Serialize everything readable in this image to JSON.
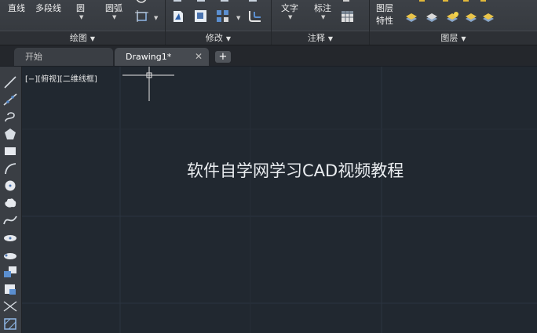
{
  "ribbon": {
    "draw": {
      "title": "绘图",
      "line": "直线",
      "polyline": "多段线",
      "circle": "圆",
      "arc": "圆弧"
    },
    "modify": {
      "title": "修改"
    },
    "annotation": {
      "title": "注释",
      "text": "文字",
      "dimension": "标注"
    },
    "layers": {
      "title": "图层",
      "layer": "图层",
      "properties": "特性"
    }
  },
  "tabs": [
    {
      "label": "开始"
    },
    {
      "label": "Drawing1*"
    }
  ],
  "tab_add": "+",
  "tab_close": "✕",
  "viewport": {
    "label": "[−][俯视][二维线框]"
  },
  "watermark": "软件自学网学习CAD视频教程",
  "colors": {
    "canvas": "#212830",
    "ribbon": "#3a3e44",
    "grid": "#2c3540",
    "accent": "#f2c12e"
  }
}
